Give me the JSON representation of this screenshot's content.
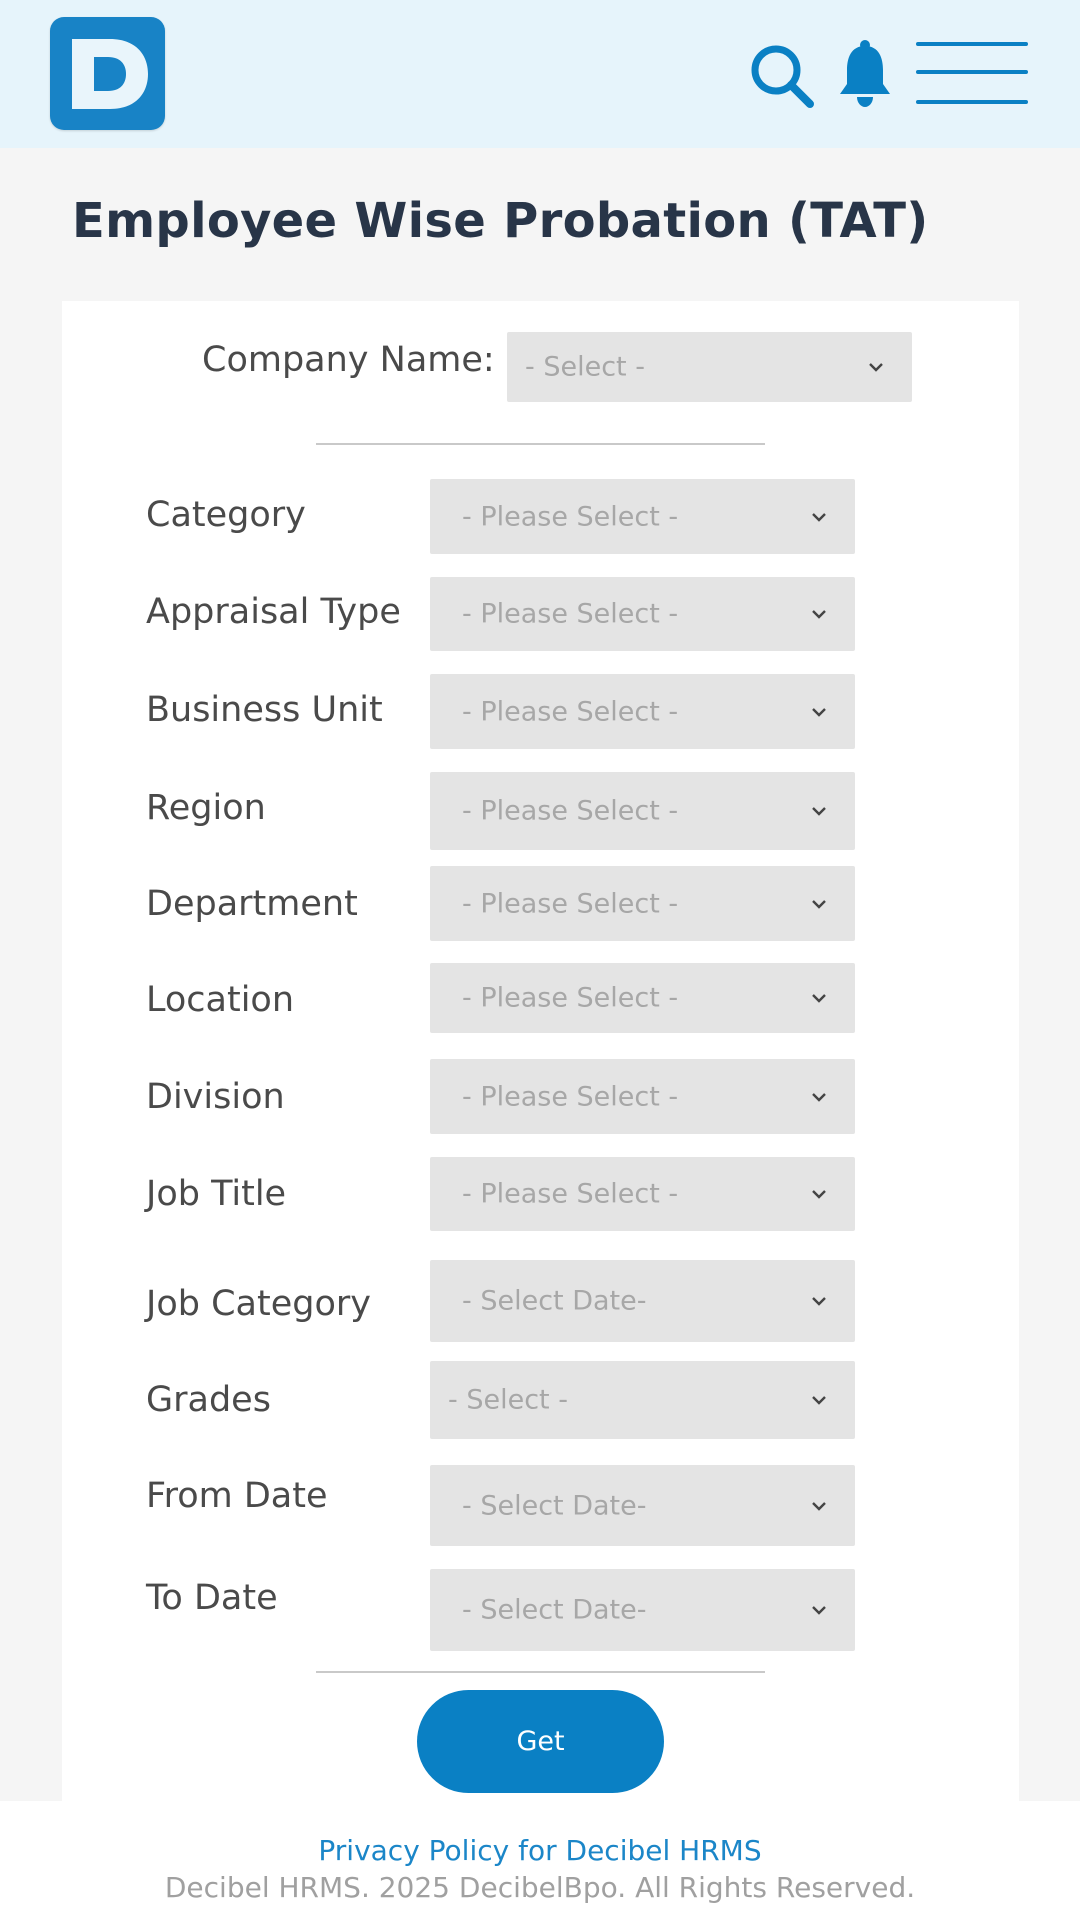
{
  "header": {
    "logo_alt": "D",
    "brand_color": "#1883c6",
    "icons": [
      "search-icon",
      "bell-icon",
      "menu-icon"
    ]
  },
  "page": {
    "title": "Employee Wise Probation (TAT)"
  },
  "form": {
    "company": {
      "label": "Company Name:",
      "placeholder": "- Select -"
    },
    "fields": [
      {
        "label": "Category",
        "placeholder": "- Please Select -"
      },
      {
        "label": "Appraisal Type",
        "placeholder": "- Please Select -"
      },
      {
        "label": "Business Unit",
        "placeholder": "- Please Select -"
      },
      {
        "label": "Region",
        "placeholder": "- Please Select -"
      },
      {
        "label": "Department",
        "placeholder": "- Please Select -"
      },
      {
        "label": "Location",
        "placeholder": "- Please Select -"
      },
      {
        "label": "Division",
        "placeholder": "- Please Select -"
      },
      {
        "label": "Job Title",
        "placeholder": "- Please Select -"
      },
      {
        "label": "Job Category",
        "placeholder": "- Select Date-"
      },
      {
        "label": "Grades",
        "placeholder": "- Select -"
      },
      {
        "label": "From Date",
        "placeholder": "- Select Date-"
      },
      {
        "label": "To Date",
        "placeholder": "- Select Date-"
      }
    ],
    "submit_label": "Get"
  },
  "footer": {
    "privacy_link": "Privacy Policy for Decibel HRMS",
    "copyright": "Decibel HRMS. 2025 DecibelBpo. All Rights Reserved."
  },
  "colors": {
    "header_bg": "#e6f4fb",
    "accent": "#0a80c4",
    "select_bg": "#e4e4e4"
  }
}
